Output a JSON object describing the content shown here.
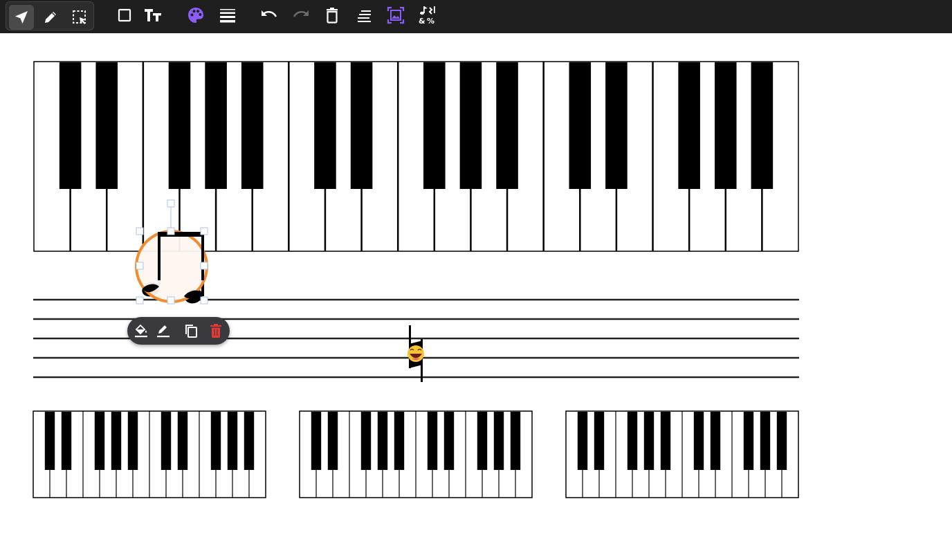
{
  "toolbar": {
    "tools": [
      {
        "name": "select-tool",
        "icon": "cursor-arrow-icon",
        "active": true
      },
      {
        "name": "pen-tool",
        "icon": "pencil-icon",
        "active": false
      },
      {
        "name": "area-select-tool",
        "icon": "dashed-select-icon",
        "active": false
      },
      {
        "name": "shape-tool",
        "icon": "square-icon",
        "active": false
      },
      {
        "name": "text-tool",
        "icon": "text-size-icon",
        "active": false
      },
      {
        "name": "color-tool",
        "icon": "palette-icon",
        "active": false
      },
      {
        "name": "line-weight-tool",
        "icon": "lines-icon",
        "active": false
      },
      {
        "name": "undo-button",
        "icon": "undo-icon",
        "active": false
      },
      {
        "name": "redo-button",
        "icon": "redo-icon",
        "active": false,
        "disabled": true
      },
      {
        "name": "delete-button",
        "icon": "trash-icon",
        "active": false
      },
      {
        "name": "align-button",
        "icon": "align-icon",
        "active": false
      },
      {
        "name": "background-image-button",
        "icon": "image-frame-icon",
        "active": false
      },
      {
        "name": "symbols-button",
        "icon": "music-symbols-icon",
        "active": false
      }
    ],
    "colors": {
      "background": "#1f1f1f",
      "icon": "#ffffff",
      "accent": "#8b5cf6",
      "disabled": "#6b6b6b"
    }
  },
  "canvas": {
    "large_keyboard": {
      "white_keys": 21,
      "black_key_pattern": [
        1,
        1,
        0,
        1,
        1,
        1,
        0
      ]
    },
    "small_keyboards": {
      "count": 3,
      "white_keys": 14
    },
    "staff_lines": 5,
    "selected_note": {
      "type": "eighth-note-pair",
      "fill": "#fdf6f0",
      "highlight": "#f08c32"
    },
    "sticker": {
      "icon": "laughing-emoji-icon",
      "symbol": "natural-sign"
    },
    "context_menu": [
      {
        "name": "fill-color-button",
        "icon": "paint-bucket-icon"
      },
      {
        "name": "stroke-color-button",
        "icon": "pen-underline-icon"
      },
      {
        "name": "duplicate-button",
        "icon": "copy-icon"
      },
      {
        "name": "delete-selection-button",
        "icon": "trash-icon",
        "color": "#e53935"
      }
    ]
  }
}
